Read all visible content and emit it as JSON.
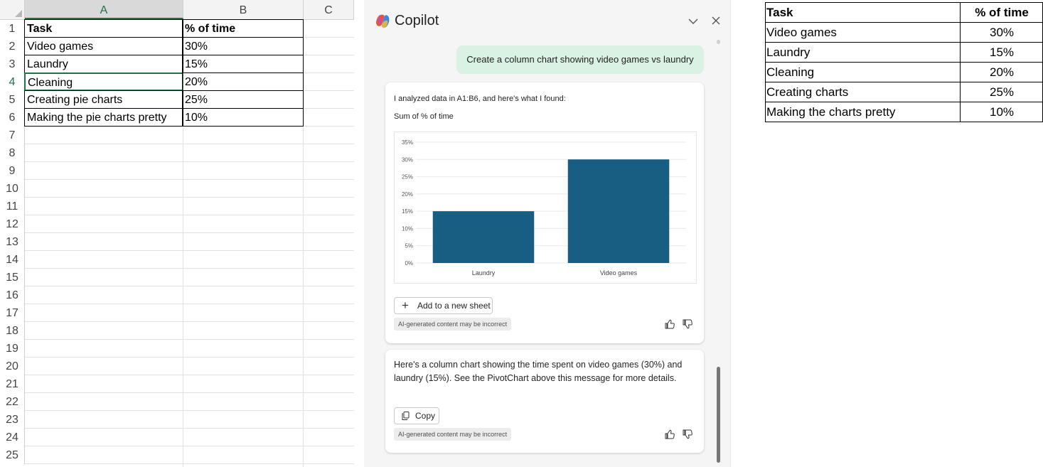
{
  "sheet": {
    "columns": [
      "A",
      "B",
      "C"
    ],
    "selected_column": "A",
    "row_numbers": [
      "1",
      "2",
      "3",
      "4",
      "5",
      "6",
      "7",
      "8",
      "9",
      "10",
      "11",
      "12",
      "13",
      "14",
      "15",
      "16",
      "17",
      "18",
      "19",
      "20",
      "21",
      "22",
      "23",
      "24",
      "25"
    ],
    "active_row": "4",
    "header": {
      "task": "Task",
      "pct": "% of time"
    },
    "rows": [
      {
        "task": "Video games",
        "pct": "30%"
      },
      {
        "task": "Laundry",
        "pct": "15%"
      },
      {
        "task": "Cleaning",
        "pct": "20%"
      },
      {
        "task": "Creating pie charts",
        "pct": "25%"
      },
      {
        "task": "Making the pie charts pretty",
        "pct": "10%"
      }
    ]
  },
  "copilot": {
    "title": "Copilot",
    "user_message": "Create a column chart showing video games vs laundry",
    "reply1": {
      "text": "I analyzed data in A1:B6, and here's what I found:",
      "subtitle": "Sum of % of time",
      "add_button": "Add to a new sheet",
      "disclaimer": "AI-generated content may be incorrect"
    },
    "reply2": {
      "text": "Here's a column chart showing the time spent on video games (30%) and laundry (15%). See the PivotChart above this message for more details.",
      "copy_button": "Copy",
      "disclaimer": "AI-generated content may be incorrect"
    },
    "colors": {
      "bar": "#175e82",
      "user_bubble": "#daf2e4"
    }
  },
  "chart_data": {
    "type": "bar",
    "title": "Sum of % of time",
    "categories": [
      "Laundry",
      "Video games"
    ],
    "values": [
      15,
      30
    ],
    "ylim": [
      0,
      35
    ],
    "yticks": [
      "0%",
      "5%",
      "10%",
      "15%",
      "20%",
      "25%",
      "30%",
      "35%"
    ],
    "grid": true,
    "bar_color": "#175e82"
  },
  "reference_table": {
    "header": {
      "task": "Task",
      "pct": "% of time"
    },
    "rows": [
      {
        "task": "Video games",
        "pct": "30%"
      },
      {
        "task": "Laundry",
        "pct": "15%"
      },
      {
        "task": "Cleaning",
        "pct": "20%"
      },
      {
        "task": "Creating charts",
        "pct": "25%"
      },
      {
        "task": "Making the charts pretty",
        "pct": "10%"
      }
    ]
  }
}
